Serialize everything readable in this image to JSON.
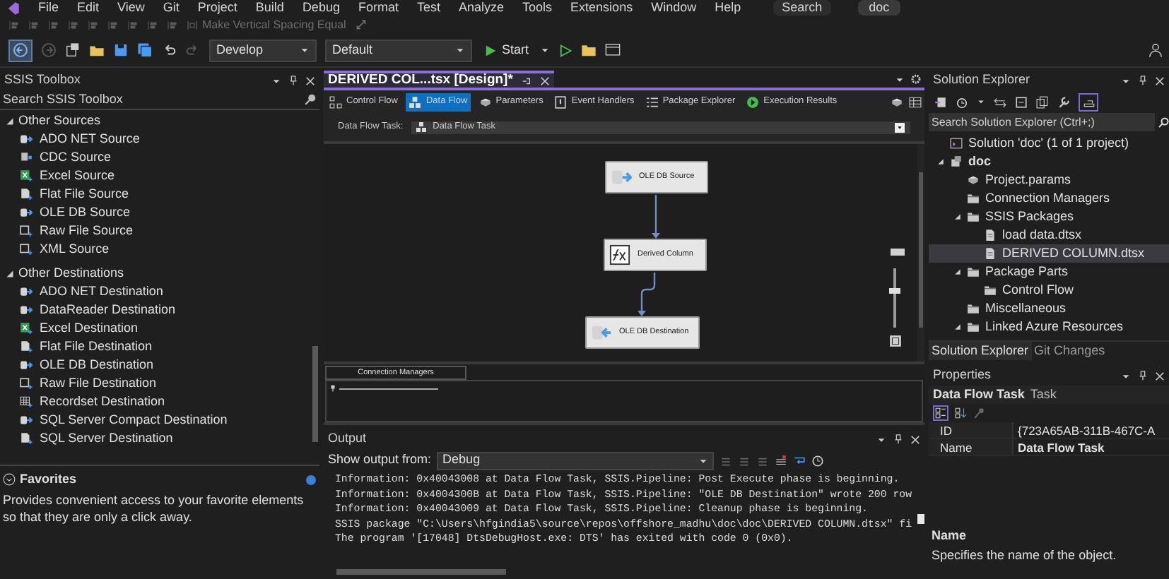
{
  "menu": [
    {
      "label": "File"
    },
    {
      "label": "Edit"
    },
    {
      "label": "View"
    },
    {
      "label": "Git"
    },
    {
      "label": "Project"
    },
    {
      "label": "Build"
    },
    {
      "label": "Debug"
    },
    {
      "label": "Format"
    },
    {
      "label": "Test"
    },
    {
      "label": "Analyze"
    },
    {
      "label": "Tools"
    },
    {
      "label": "Extensions"
    },
    {
      "label": "Window"
    },
    {
      "label": "Help"
    }
  ],
  "title_search": "Search",
  "solution_badge": "doc",
  "layout_toolbar": {
    "label": "Make Vertical Spacing Equal",
    "disabled": true
  },
  "standard_toolbar": {
    "configuration": "Develop",
    "platform": "Default",
    "start": "Start"
  },
  "toolbox": {
    "title": "SSIS Toolbox",
    "search_placeholder": "Search SSIS Toolbox",
    "groups": [
      {
        "label": "Other Sources",
        "expanded": true,
        "items": [
          {
            "label": "ADO NET Source",
            "kind": "db"
          },
          {
            "label": "CDC Source",
            "kind": "cdc"
          },
          {
            "label": "Excel Source",
            "kind": "excel"
          },
          {
            "label": "Flat File Source",
            "kind": "file"
          },
          {
            "label": "OLE DB Source",
            "kind": "db"
          },
          {
            "label": "Raw File Source",
            "kind": "raw"
          },
          {
            "label": "XML Source",
            "kind": "raw"
          }
        ]
      },
      {
        "label": "Other Destinations",
        "expanded": true,
        "items": [
          {
            "label": "ADO NET Destination",
            "kind": "db"
          },
          {
            "label": "DataReader Destination",
            "kind": "db"
          },
          {
            "label": "Excel Destination",
            "kind": "excel"
          },
          {
            "label": "Flat File Destination",
            "kind": "file"
          },
          {
            "label": "OLE DB Destination",
            "kind": "db"
          },
          {
            "label": "Raw File Destination",
            "kind": "raw"
          },
          {
            "label": "Recordset Destination",
            "kind": "grid"
          },
          {
            "label": "SQL Server Compact Destination",
            "kind": "db"
          },
          {
            "label": "SQL Server Destination",
            "kind": "file"
          }
        ]
      }
    ],
    "favorites": {
      "title": "Favorites",
      "description": "Provides convenient access to your favorite elements so that they are only a click away."
    }
  },
  "document": {
    "tab": "DERIVED COL...tsx [Design]*",
    "designer_tabs": [
      {
        "label": "Control Flow",
        "kind": "control",
        "selected": false
      },
      {
        "label": "Data Flow",
        "kind": "dataflow",
        "selected": true
      },
      {
        "label": "Parameters",
        "kind": "params",
        "selected": false
      },
      {
        "label": "Event Handlers",
        "kind": "events",
        "selected": false
      },
      {
        "label": "Package Explorer",
        "kind": "explorer",
        "selected": false
      },
      {
        "label": "Execution Results",
        "kind": "results",
        "selected": false
      }
    ],
    "task_label": "Data Flow Task:",
    "task_value": "Data Flow Task",
    "canvas": {
      "nodes": [
        {
          "label": "OLE DB Source",
          "kind": "source"
        },
        {
          "label": "Derived Column",
          "kind": "derived"
        },
        {
          "label": "OLE DB Destination",
          "kind": "destination"
        }
      ],
      "zoom": {
        "level": 0.63
      }
    },
    "connection_managers_tab": "Connection Managers"
  },
  "output": {
    "title": "Output",
    "show_label": "Show output from:",
    "source": "Debug",
    "lines": [
      "Information: 0x40043008 at Data Flow Task, SSIS.Pipeline: Post Execute phase is beginning.",
      "Information: 0x4004300B at Data Flow Task, SSIS.Pipeline: \"OLE DB Destination\" wrote 200 row",
      "Information: 0x40043009 at Data Flow Task, SSIS.Pipeline: Cleanup phase is beginning.",
      "SSIS package \"C:\\Users\\hfgindia5\\source\\repos\\offshore_madhu\\doc\\doc\\DERIVED COLUMN.dtsx\" fi",
      "The program '[17048] DtsDebugHost.exe: DTS' has exited with code 0 (0x0)."
    ]
  },
  "solution_explorer": {
    "title": "Solution Explorer",
    "search_placeholder": "Search Solution Explorer (Ctrl+;)",
    "tree": [
      {
        "label": "Solution 'doc' (1 of 1 project)",
        "kind": "solution",
        "selected": false
      },
      {
        "label": "doc",
        "kind": "project",
        "selected": false,
        "expanded": true,
        "children": [
          {
            "label": "Project.params",
            "kind": "params",
            "selected": false
          },
          {
            "label": "Connection Managers",
            "kind": "folder",
            "selected": false
          },
          {
            "label": "SSIS Packages",
            "kind": "folder",
            "selected": false,
            "expanded": true,
            "children": [
              {
                "label": "load data.dtsx",
                "kind": "package",
                "selected": false
              },
              {
                "label": "DERIVED COLUMN.dtsx",
                "kind": "package",
                "selected": true
              }
            ]
          },
          {
            "label": "Package Parts",
            "kind": "folder",
            "selected": false,
            "expanded": true,
            "children": [
              {
                "label": "Control Flow",
                "kind": "folder",
                "selected": false
              }
            ]
          },
          {
            "label": "Miscellaneous",
            "kind": "folder",
            "selected": false
          },
          {
            "label": "Linked Azure Resources",
            "kind": "folder",
            "selected": false,
            "expanded": true
          }
        ]
      }
    ],
    "tabs": [
      {
        "label": "Solution Explorer",
        "selected": true
      },
      {
        "label": "Git Changes",
        "selected": false
      }
    ]
  },
  "properties": {
    "title": "Properties",
    "object": "Data Flow Task",
    "object_type": "Task",
    "rows": [
      {
        "name": "ID",
        "value": "{723A65AB-311B-467C-A"
      },
      {
        "name": "Name",
        "value": "Data Flow Task"
      }
    ],
    "description_title": "Name",
    "description": "Specifies the name of the object."
  }
}
